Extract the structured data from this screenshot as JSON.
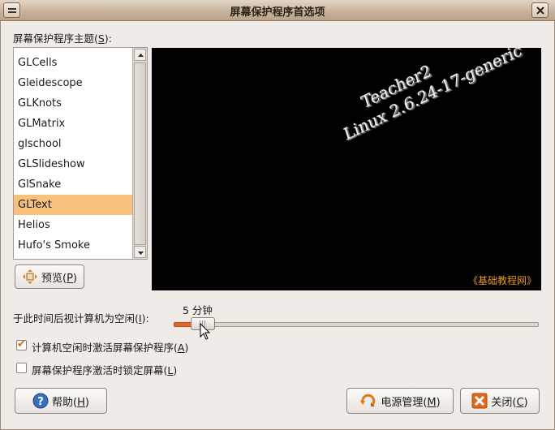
{
  "window": {
    "title": "屏幕保护程序首选项"
  },
  "theme_label": {
    "text": "屏幕保护程序主题(",
    "accel": "S",
    "suffix": "):"
  },
  "themes": {
    "items": [
      "GLCells",
      "Gleidescope",
      "GLKnots",
      "GLMatrix",
      "glschool",
      "GLSlideshow",
      "GlSnake",
      "GLText",
      "Helios",
      "Hufo's Smoke"
    ],
    "selected_index": 7
  },
  "preview": {
    "line1": "Teacher2",
    "line2": "Linux 2.6.24-17-generic",
    "watermark": "《基础教程网》",
    "preview_button": {
      "text": "预览(",
      "accel": "P",
      "suffix": ")"
    }
  },
  "idle": {
    "label": "于此时间后视计算机为空闲(",
    "accel": "I",
    "suffix": "):",
    "value_text": "5 分钟",
    "fraction": 0.04
  },
  "options": {
    "activate": {
      "label": "计算机空闲时激活屏幕保护程序(",
      "accel": "A",
      "suffix": ")",
      "checked": true
    },
    "lock": {
      "label": "屏幕保护程序激活时锁定屏幕(",
      "accel": "L",
      "suffix": ")",
      "checked": false
    }
  },
  "buttons": {
    "help": {
      "text": "帮助(",
      "accel": "H",
      "suffix": ")"
    },
    "power": {
      "text": "电源管理(",
      "accel": "M",
      "suffix": ")"
    },
    "close": {
      "text": "关闭(",
      "accel": "C",
      "suffix": ")"
    }
  },
  "colors": {
    "selection": "#f8c27e",
    "accent": "#e86a2a",
    "watermark": "#e89a2a"
  }
}
